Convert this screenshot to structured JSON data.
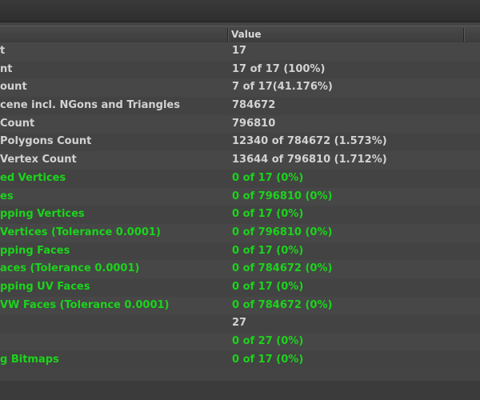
{
  "header": {
    "col_name": "",
    "col_value": "Value"
  },
  "rows": [
    {
      "name": "t",
      "value": "17",
      "status": "normal"
    },
    {
      "name": "nt",
      "value": "17 of 17 (100%)",
      "status": "normal"
    },
    {
      "name": "ount",
      "value": "7 of 17(41.176%)",
      "status": "normal"
    },
    {
      "name": "cene incl. NGons and Triangles",
      "value": "784672",
      "status": "normal"
    },
    {
      "name": "Count",
      "value": "796810",
      "status": "normal"
    },
    {
      "name": "Polygons Count",
      "value": "12340 of 784672 (1.573%)",
      "status": "normal"
    },
    {
      "name": "Vertex Count",
      "value": "13644 of 796810 (1.712%)",
      "status": "normal"
    },
    {
      "name": "ed Vertices",
      "value": "0 of 17 (0%)",
      "status": "ok"
    },
    {
      "name": "es",
      "value": "0 of 796810 (0%)",
      "status": "ok"
    },
    {
      "name": "pping Vertices",
      "value": "0 of 17 (0%)",
      "status": "ok"
    },
    {
      "name": "Vertices (Tolerance 0.0001)",
      "value": "0 of 796810 (0%)",
      "status": "ok"
    },
    {
      "name": "pping Faces",
      "value": "0 of 17 (0%)",
      "status": "ok"
    },
    {
      "name": "aces (Tolerance 0.0001)",
      "value": "0 of 784672 (0%)",
      "status": "ok"
    },
    {
      "name": "pping UV Faces",
      "value": "0 of 17 (0%)",
      "status": "ok"
    },
    {
      "name": "VW Faces (Tolerance 0.0001)",
      "value": "0 of 784672 (0%)",
      "status": "ok"
    },
    {
      "name": "",
      "value": "27",
      "status": "normal"
    },
    {
      "name": "",
      "value": "0 of 27 (0%)",
      "status": "ok"
    },
    {
      "name": "g Bitmaps",
      "value": "0 of 17 (0%)",
      "status": "ok"
    }
  ],
  "colors": {
    "ok_text": "#1bd41b",
    "normal_text": "#d2d2d2",
    "background": "#444444"
  }
}
